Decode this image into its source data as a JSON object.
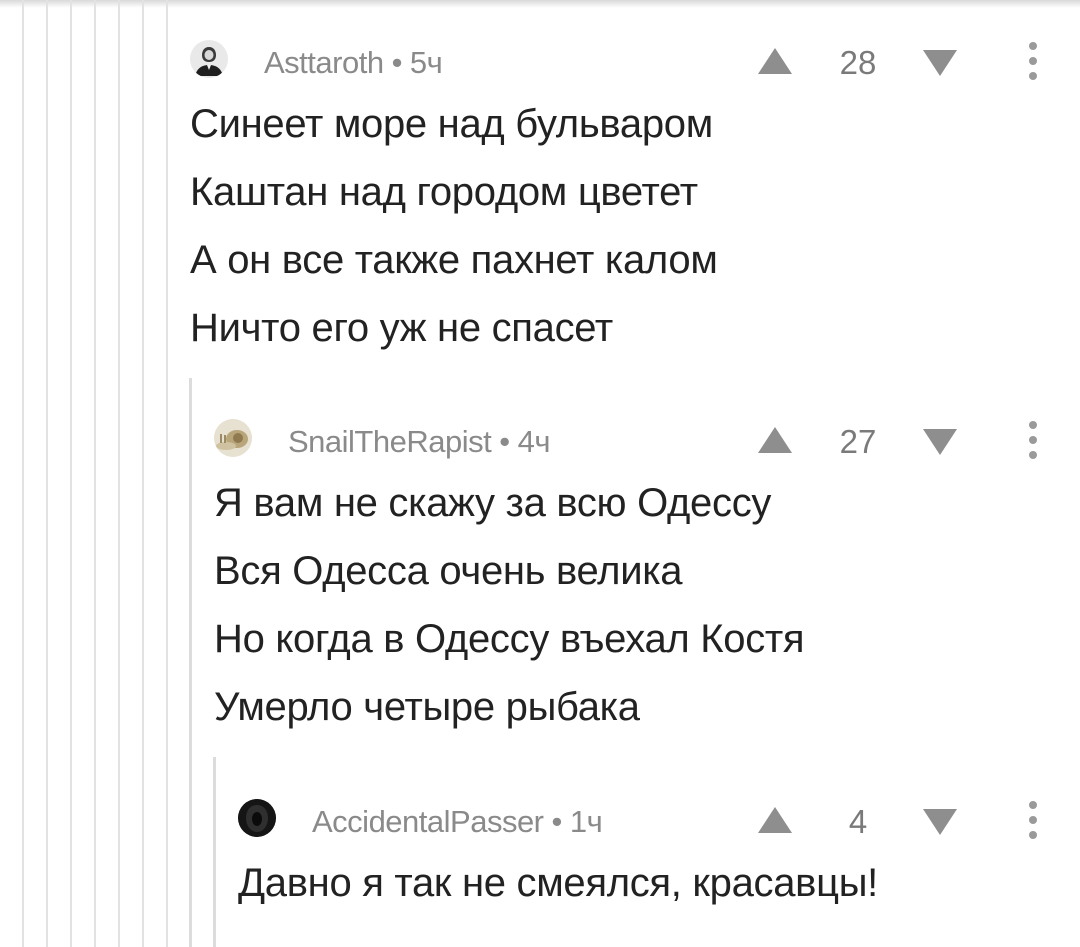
{
  "comments": [
    {
      "author": "Asttaroth",
      "time": "5ч",
      "score": "28",
      "lines": [
        "Синеет море над бульваром",
        "Каштан над городом цветет",
        "А он все также пахнет калом",
        "Ничто его уж не спасет"
      ]
    },
    {
      "author": "SnailTheRapist",
      "time": "4ч",
      "score": "27",
      "lines": [
        "Я вам не скажу за всю Одессу",
        "Вся Одесса очень велика",
        "Но когда в Одессу въехал Костя",
        "Умерло четыре рыбака"
      ]
    },
    {
      "author": "AccidentalPasser",
      "time": "1ч",
      "score": "4",
      "lines": [
        "Давно я так не смеялся, красавцы!"
      ]
    }
  ],
  "separator": "•",
  "icons": {
    "upvote": "upvote-icon",
    "downvote": "downvote-icon",
    "more": "more-options-icon"
  }
}
